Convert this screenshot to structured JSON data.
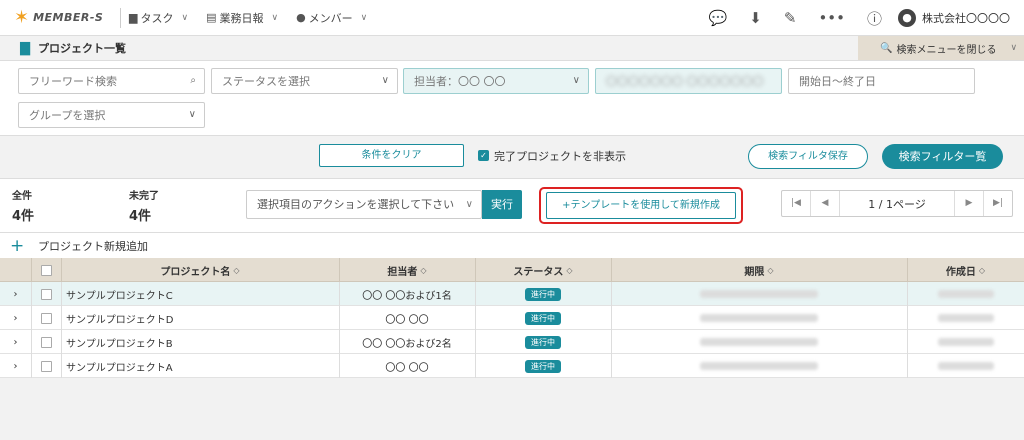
{
  "header": {
    "logo_text": "MEMBER-S",
    "nav": [
      {
        "label": "タスク",
        "icon": "file-icon"
      },
      {
        "label": "業務日報",
        "icon": "book-icon"
      },
      {
        "label": "メンバー",
        "icon": "person-icon"
      }
    ],
    "tools": [
      "chat-icon",
      "download-file-icon",
      "pencil-icon",
      "more-icon",
      "info-icon"
    ],
    "company": "株式会社〇〇〇〇"
  },
  "titlebar": {
    "title": "プロジェクト一覧",
    "search_close": "検索メニューを閉じる"
  },
  "filters": {
    "freeword_placeholder": "フリーワード検索",
    "status_placeholder": "ステータスを選択",
    "assignee_value": "担当者：〇〇 〇〇",
    "blurred_value": "〇〇〇〇〇〇〇 〇〇〇〇〇〇〇",
    "date_placeholder": "開始日～終了日",
    "group_placeholder": "グループを選択"
  },
  "actions": {
    "clear_label": "条件をクリア",
    "hide_completed_label": "完了プロジェクトを非表示",
    "hide_completed_checked": true,
    "save_filter_label": "検索フィルタ保存",
    "filter_list_label": "検索フィルター覧"
  },
  "counts": {
    "total_label": "全件",
    "total_value": "4件",
    "incomplete_label": "未完了",
    "incomplete_value": "4件"
  },
  "bulk": {
    "select_placeholder": "選択項目のアクションを選択して下さい",
    "execute_label": "実行",
    "template_label": "+テンプレートを使用して新規作成"
  },
  "pager": {
    "label": "1 / 1ページ"
  },
  "add_new_label": "プロジェクト新規追加",
  "table": {
    "columns": [
      "プロジェクト名",
      "担当者",
      "ステータス",
      "期限",
      "作成日"
    ],
    "rows": [
      {
        "name": "サンプルプロジェクトC",
        "assignee": "〇〇 〇〇および1名",
        "status": "進行中"
      },
      {
        "name": "サンプルプロジェクトD",
        "assignee": "〇〇 〇〇",
        "status": "進行中"
      },
      {
        "name": "サンプルプロジェクトB",
        "assignee": "〇〇 〇〇および2名",
        "status": "進行中"
      },
      {
        "name": "サンプルプロジェクトA",
        "assignee": "〇〇 〇〇",
        "status": "進行中"
      }
    ]
  },
  "colors": {
    "accent": "#1a8c9c",
    "header_tan": "#e4ddd1",
    "highlight": "#dd2222"
  }
}
